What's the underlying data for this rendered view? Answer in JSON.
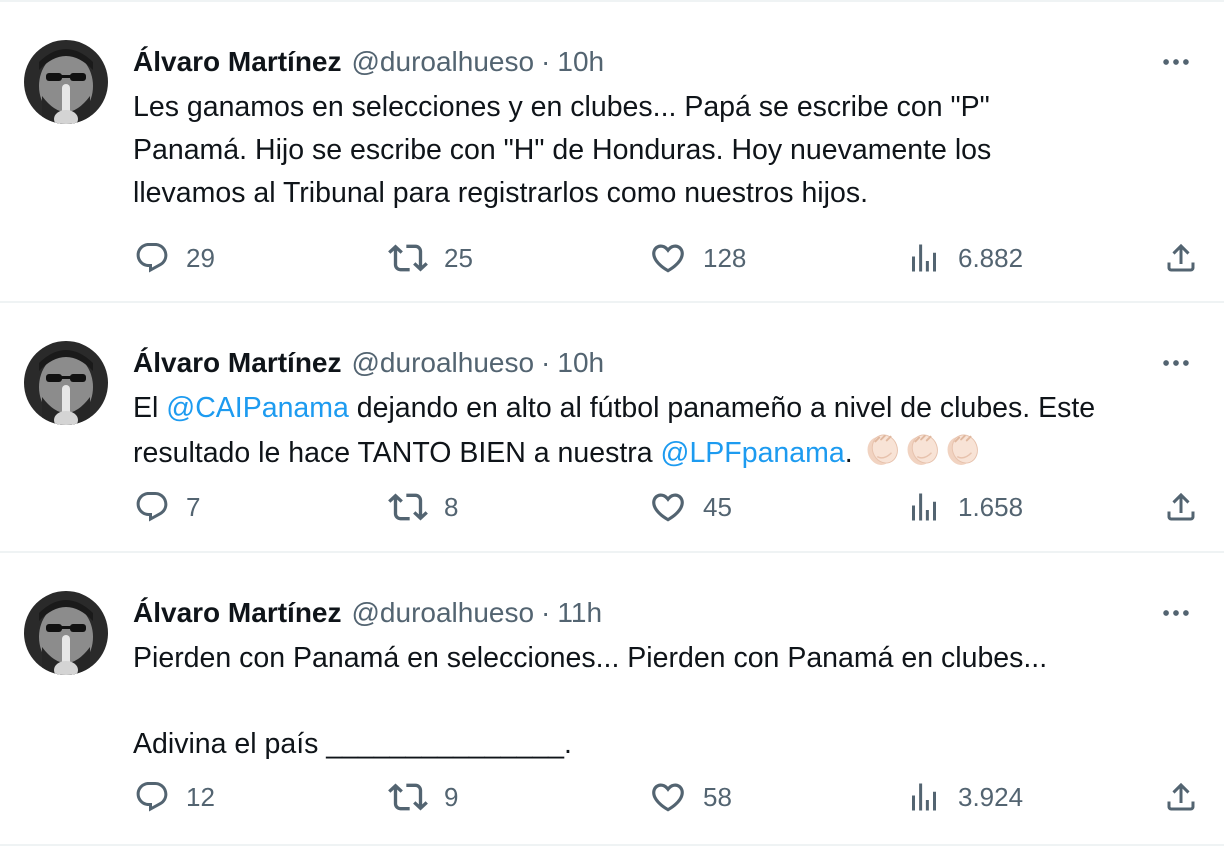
{
  "colors": {
    "text": "#0f1419",
    "secondary": "#536471",
    "mention": "#1d9bf0",
    "divider": "#eff3f4"
  },
  "icons": {
    "reply": "speech-bubble-icon",
    "retweet": "retweet-arrows-icon",
    "like": "heart-icon",
    "views": "bar-chart-icon",
    "share": "upload-arrow-icon",
    "more": "three-dots-icon",
    "clap": "clapping-hands-emoji"
  },
  "tweets": [
    {
      "author": {
        "name": "Álvaro Martínez",
        "handle": "@duroalhueso"
      },
      "separator": "·",
      "time": "10h",
      "lines": [
        "Les ganamos en selecciones y en clubes... Papá se escribe con \"P\"",
        "Panamá. Hijo se escribe con \"H\" de Honduras. Hoy nuevamente los",
        "llevamos al Tribunal para registrarlos como nuestros hijos."
      ],
      "stats": {
        "replies": "29",
        "retweets": "25",
        "likes": "128",
        "views": "6.882"
      }
    },
    {
      "author": {
        "name": "Álvaro Martínez",
        "handle": "@duroalhueso"
      },
      "separator": "·",
      "time": "10h",
      "segments": {
        "l1_a": "El ",
        "l1_mention": "@CAIPanama",
        "l1_b": " dejando en alto al fútbol panameño a nivel de clubes. Este",
        "l2_a": "resultado le hace TANTO BIEN a nuestra ",
        "l2_mention": "@LPFpanama",
        "l2_b": ". "
      },
      "emoji_count": 3,
      "stats": {
        "replies": "7",
        "retweets": "8",
        "likes": "45",
        "views": "1.658"
      }
    },
    {
      "author": {
        "name": "Álvaro Martínez",
        "handle": "@duroalhueso"
      },
      "separator": "·",
      "time": "11h",
      "lines": [
        "Pierden con Panamá en selecciones... Pierden con Panamá en clubes...",
        "",
        "Adivina el país _______________."
      ],
      "stats": {
        "replies": "12",
        "retweets": "9",
        "likes": "58",
        "views": "3.924"
      }
    }
  ]
}
